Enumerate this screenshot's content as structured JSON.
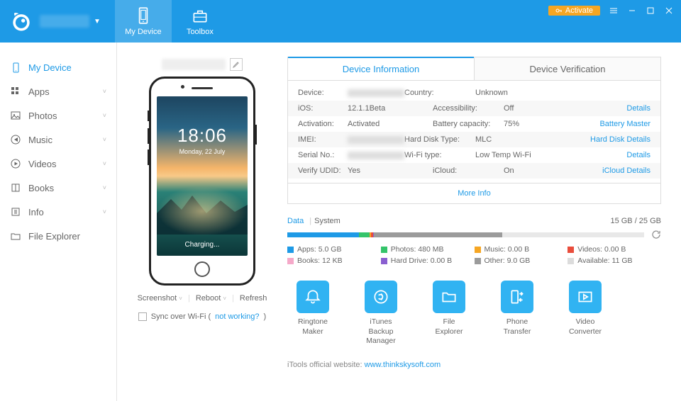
{
  "header": {
    "activate": "Activate",
    "nav": [
      {
        "label": "My Device"
      },
      {
        "label": "Toolbox"
      }
    ]
  },
  "sidebar": [
    {
      "label": "My Device",
      "icon": "device",
      "expandable": false,
      "active": true
    },
    {
      "label": "Apps",
      "icon": "grid",
      "expandable": true
    },
    {
      "label": "Photos",
      "icon": "photo",
      "expandable": true
    },
    {
      "label": "Music",
      "icon": "music",
      "expandable": true
    },
    {
      "label": "Videos",
      "icon": "video",
      "expandable": true
    },
    {
      "label": "Books",
      "icon": "book",
      "expandable": true
    },
    {
      "label": "Info",
      "icon": "info",
      "expandable": true
    },
    {
      "label": "File Explorer",
      "icon": "folder",
      "expandable": false
    }
  ],
  "phone": {
    "time": "18:06",
    "date": "Monday, 22 July",
    "status": "Charging...",
    "actions": {
      "screenshot": "Screenshot",
      "reboot": "Reboot",
      "refresh": "Refresh"
    },
    "sync": {
      "label": "Sync over Wi-Fi (",
      "link": "not working?",
      "close": ")"
    }
  },
  "tabs": [
    {
      "label": "Device Information",
      "active": true
    },
    {
      "label": "Device Verification"
    }
  ],
  "info": {
    "rows": [
      {
        "l1": "Device:",
        "v1blur": true,
        "l2": "Country:",
        "v2": "Unknown"
      },
      {
        "l1": "iOS:",
        "v1": "12.1.1Beta",
        "l2": "Accessibility:",
        "v2": "Off",
        "link": "Details",
        "alt": true
      },
      {
        "l1": "Activation:",
        "v1": "Activated",
        "l2": "Battery capacity:",
        "v2": "75%",
        "link": "Battery Master"
      },
      {
        "l1": "IMEI:",
        "v1blur": true,
        "l2": "Hard Disk Type:",
        "v2": "MLC",
        "link": "Hard Disk Details",
        "alt": true
      },
      {
        "l1": "Serial No.:",
        "v1blur": true,
        "l2": "Wi-Fi type:",
        "v2": "Low Temp Wi-Fi",
        "link": "Details"
      },
      {
        "l1": "Verify UDID:",
        "v1": "Yes",
        "l2": "iCloud:",
        "v2": "On",
        "link": "iCloud Details",
        "alt": true
      }
    ],
    "more": "More Info"
  },
  "storage": {
    "data_label": "Data",
    "system_label": "System",
    "total": "15 GB / 25 GB",
    "segments": [
      {
        "color": "#1e9ae6",
        "pct": 20
      },
      {
        "color": "#34c46a",
        "pct": 3
      },
      {
        "color": "#f6a623",
        "pct": 0.5
      },
      {
        "color": "#e94d3c",
        "pct": 0.5
      },
      {
        "color": "#f5a9c9",
        "pct": 0.1
      },
      {
        "color": "#8a5fd0",
        "pct": 0.1
      },
      {
        "color": "#9b9b9b",
        "pct": 36
      }
    ],
    "legend": [
      {
        "color": "#1e9ae6",
        "text": "Apps: 5.0 GB"
      },
      {
        "color": "#34c46a",
        "text": "Photos: 480 MB"
      },
      {
        "color": "#f6a623",
        "text": "Music: 0.00 B"
      },
      {
        "color": "#e94d3c",
        "text": "Videos: 0.00 B"
      },
      {
        "color": "#f5a9c9",
        "text": "Books: 12 KB"
      },
      {
        "color": "#8a5fd0",
        "text": "Hard Drive: 0.00 B"
      },
      {
        "color": "#9b9b9b",
        "text": "Other: 9.0 GB"
      },
      {
        "color": "#dcdcdc",
        "text": "Available: 11 GB"
      }
    ]
  },
  "tools": [
    {
      "label": "Ringtone Maker",
      "icon": "bell"
    },
    {
      "label": "iTunes Backup Manager",
      "icon": "backup"
    },
    {
      "label": "File Explorer",
      "icon": "folderO"
    },
    {
      "label": "Phone Transfer",
      "icon": "transfer"
    },
    {
      "label": "Video Converter",
      "icon": "videoC"
    }
  ],
  "footer": {
    "text": "iTools official website: ",
    "link": "www.thinkskysoft.com"
  }
}
